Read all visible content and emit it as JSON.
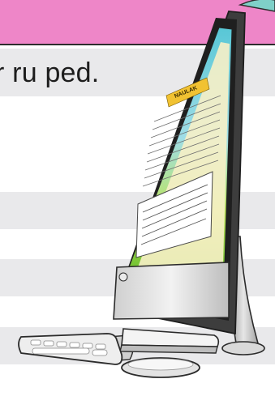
{
  "header": {
    "color": "#ee86c8"
  },
  "row1": {
    "text": "r ru ped."
  },
  "stripe_color": "#e9e9eb",
  "illustration": {
    "icon": "imac-computer-with-keyboard-and-mouse",
    "screen_heading": "NAULAK"
  }
}
